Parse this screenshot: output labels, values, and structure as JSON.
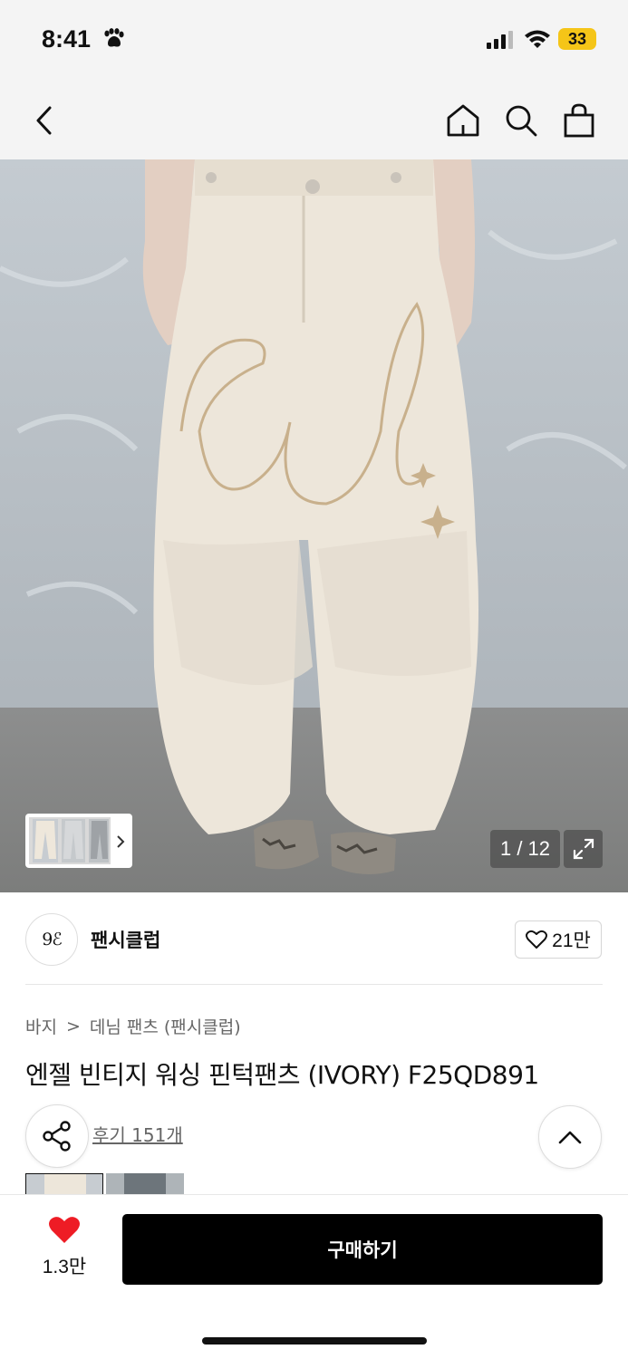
{
  "status_bar": {
    "time": "8:41",
    "battery": "33"
  },
  "nav": {
    "back_icon": "chevron-left-icon",
    "home_icon": "home-icon",
    "search_icon": "search-icon",
    "cart_icon": "shopping-bag-icon"
  },
  "gallery": {
    "counter": "1 / 12",
    "thumb_icon": "chevron-right-icon",
    "expand_icon": "expand-icon"
  },
  "brand": {
    "logo_text": "9ℰ",
    "name": "팬시클럽",
    "likes": "21만"
  },
  "breadcrumb": {
    "category": "바지",
    "separator": ">",
    "subcategory": "데님 팬츠 (팬시클럽)"
  },
  "product": {
    "title": "엔젤 빈티지 워싱 핀턱팬츠 (IVORY) F25QD891",
    "reviews": "후기 151개"
  },
  "bottom": {
    "wish_count": "1.3만",
    "buy_label": "구매하기"
  },
  "colors": {
    "accent": "#000000",
    "wish_heart": "#ee1c25",
    "battery": "#f5c518"
  }
}
